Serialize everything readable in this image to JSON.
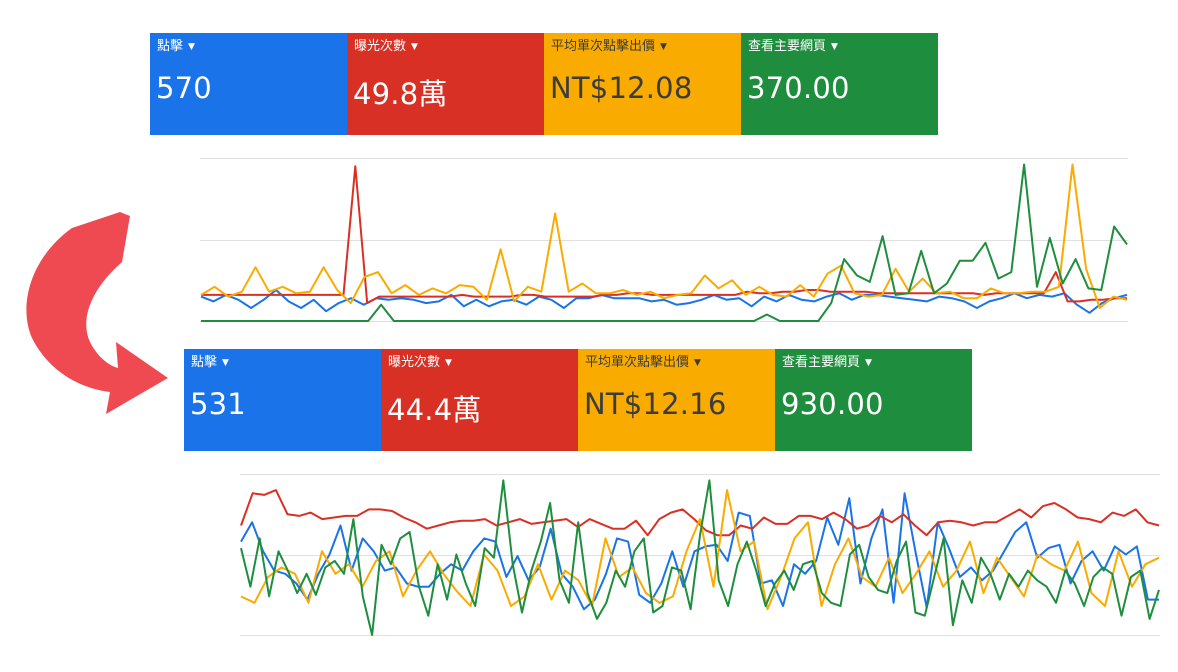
{
  "colors": {
    "blue": "#1a73e8",
    "red": "#d93025",
    "orange": "#f9ab00",
    "green": "#1e8e3e",
    "grid": "#e0e0e0",
    "arrow": "#ef4a52"
  },
  "before": {
    "cards": [
      {
        "label": "點擊",
        "value": "570",
        "color": "blue"
      },
      {
        "label": "曝光次數",
        "value": "49.8萬",
        "color": "red"
      },
      {
        "label": "平均單次點擊出價",
        "value": "NT$12.08",
        "color": "orange"
      },
      {
        "label": "查看主要網頁",
        "value": "370.00",
        "color": "green"
      }
    ]
  },
  "after": {
    "cards": [
      {
        "label": "點擊",
        "value": "531",
        "color": "blue"
      },
      {
        "label": "曝光次數",
        "value": "44.4萬",
        "color": "red"
      },
      {
        "label": "平均單次點擊出價",
        "value": "NT$12.16",
        "color": "orange"
      },
      {
        "label": "查看主要網頁",
        "value": "930.00",
        "color": "green"
      }
    ]
  },
  "chart_data": [
    {
      "type": "line",
      "title": "",
      "ylim": [
        0,
        100
      ],
      "grid": true,
      "series": [
        {
          "color": "blue",
          "values": [
            15,
            12,
            16,
            13,
            8,
            13,
            19,
            12,
            8,
            13,
            6,
            11,
            14,
            10,
            14,
            13,
            14,
            13,
            11,
            12,
            16,
            9,
            13,
            9,
            12,
            13,
            10,
            15,
            13,
            8,
            14,
            14,
            16,
            14,
            14,
            14,
            12,
            13,
            10,
            11,
            13,
            16,
            13,
            14,
            9,
            15,
            12,
            16,
            13,
            12,
            15,
            17,
            13,
            16,
            16,
            15,
            14,
            13,
            12,
            15,
            14,
            12,
            8,
            12,
            14,
            17,
            14,
            16,
            15,
            17,
            10,
            5,
            11,
            14,
            16
          ]
        },
        {
          "color": "red",
          "values": [
            16,
            16,
            16,
            16,
            16,
            16,
            16,
            16,
            16,
            16,
            16,
            16,
            16,
            95,
            11,
            15,
            15,
            15,
            15,
            15,
            15,
            15,
            16,
            15,
            15,
            15,
            15,
            16,
            16,
            15,
            15,
            15,
            15,
            15,
            16,
            16,
            17,
            17,
            16,
            16,
            16,
            16,
            16,
            16,
            16,
            16,
            18,
            17,
            17,
            18,
            18,
            19,
            19,
            18,
            18,
            18,
            18,
            17,
            17,
            17,
            17,
            17,
            17,
            17,
            17,
            17,
            16,
            17,
            17,
            17,
            17,
            17,
            30,
            12,
            12,
            13,
            13,
            14,
            14
          ]
        },
        {
          "color": "orange",
          "values": [
            16,
            21,
            15,
            18,
            33,
            18,
            21,
            17,
            18,
            33,
            19,
            11,
            27,
            30,
            17,
            22,
            16,
            20,
            17,
            22,
            21,
            13,
            44,
            12,
            21,
            18,
            66,
            18,
            23,
            17,
            17,
            19,
            16,
            18,
            14,
            16,
            17,
            28,
            20,
            25,
            16,
            21,
            16,
            15,
            22,
            15,
            29,
            34,
            17,
            15,
            16,
            32,
            18,
            26,
            17,
            18,
            14,
            14,
            20,
            17,
            17,
            18,
            18,
            21,
            96,
            32,
            8,
            15,
            13
          ]
        },
        {
          "color": "green",
          "values": [
            0,
            0,
            0,
            0,
            0,
            0,
            0,
            0,
            0,
            0,
            0,
            0,
            0,
            0,
            10,
            0,
            0,
            0,
            0,
            0,
            0,
            0,
            0,
            0,
            0,
            0,
            0,
            0,
            0,
            0,
            0,
            0,
            0,
            0,
            0,
            0,
            0,
            0,
            0,
            0,
            0,
            0,
            0,
            0,
            4,
            0,
            0,
            0,
            0,
            11,
            38,
            28,
            24,
            52,
            16,
            17,
            43,
            17,
            23,
            37,
            37,
            48,
            26,
            30,
            96,
            21,
            51,
            23,
            38,
            20,
            19,
            58,
            47
          ]
        }
      ]
    },
    {
      "type": "line",
      "title": "",
      "ylim": [
        0,
        100
      ],
      "grid": true,
      "series": [
        {
          "color": "blue",
          "values": [
            58,
            70,
            52,
            40,
            38,
            32,
            22,
            38,
            50,
            68,
            40,
            60,
            52,
            40,
            42,
            32,
            30,
            30,
            38,
            44,
            40,
            52,
            60,
            58,
            36,
            49,
            34,
            42,
            66,
            38,
            30,
            16,
            22,
            38,
            60,
            58,
            25,
            20,
            32,
            52,
            30,
            52,
            55,
            56,
            46,
            76,
            74,
            32,
            34,
            18,
            44,
            38,
            46,
            73,
            56,
            85,
            32,
            60,
            78,
            20,
            88,
            51,
            17,
            70,
            54,
            36,
            42,
            34,
            40,
            52,
            64,
            70,
            48,
            54,
            56,
            32,
            46,
            52,
            40,
            55,
            50,
            55,
            22,
            22
          ]
        },
        {
          "color": "red",
          "values": [
            68,
            88,
            87,
            90,
            75,
            74,
            76,
            72,
            73,
            74,
            74,
            78,
            78,
            77,
            73,
            70,
            66,
            68,
            70,
            71,
            71,
            72,
            68,
            70,
            72,
            69,
            70,
            71,
            72,
            67,
            72,
            69,
            66,
            66,
            71,
            62,
            72,
            76,
            78,
            72,
            65,
            62,
            62,
            68,
            66,
            73,
            69,
            69,
            74,
            74,
            72,
            76,
            72,
            66,
            68,
            74,
            70,
            75,
            68,
            62,
            70,
            71,
            70,
            68,
            70,
            70,
            74,
            78,
            73,
            80,
            82,
            78,
            73,
            72,
            70,
            76,
            74,
            78,
            70,
            68
          ]
        },
        {
          "color": "orange",
          "values": [
            24,
            20,
            36,
            42,
            38,
            20,
            52,
            38,
            44,
            30,
            46,
            52,
            24,
            40,
            52,
            38,
            27,
            18,
            50,
            40,
            18,
            24,
            44,
            22,
            40,
            34,
            18,
            60,
            36,
            42,
            26,
            20,
            24,
            52,
            72,
            30,
            90,
            52,
            58,
            16,
            36,
            60,
            70,
            18,
            44,
            60,
            36,
            30,
            48,
            26,
            38,
            52,
            30,
            40,
            58,
            26,
            48,
            36,
            24,
            50,
            44,
            40,
            58,
            26,
            18,
            52,
            30,
            44,
            48
          ]
        },
        {
          "color": "green",
          "values": [
            54,
            30,
            60,
            24,
            52,
            40,
            26,
            38,
            25,
            42,
            46,
            38,
            72,
            24,
            0,
            56,
            44,
            60,
            64,
            30,
            12,
            44,
            22,
            50,
            32,
            18,
            54,
            48,
            96,
            44,
            14,
            40,
            58,
            82,
            34,
            20,
            70,
            26,
            10,
            20,
            40,
            30,
            52,
            60,
            14,
            18,
            42,
            40,
            16,
            62,
            96,
            34,
            18,
            44,
            58,
            40,
            18,
            32,
            40,
            28,
            44,
            46,
            26,
            20,
            18,
            50,
            56,
            36,
            28,
            26,
            46,
            58,
            14,
            12,
            36,
            60,
            6,
            34,
            20,
            48,
            38,
            22,
            38,
            30,
            40,
            34,
            30,
            20,
            40,
            32,
            18,
            36,
            42,
            38,
            12,
            36,
            40,
            10,
            28
          ]
        }
      ]
    }
  ]
}
